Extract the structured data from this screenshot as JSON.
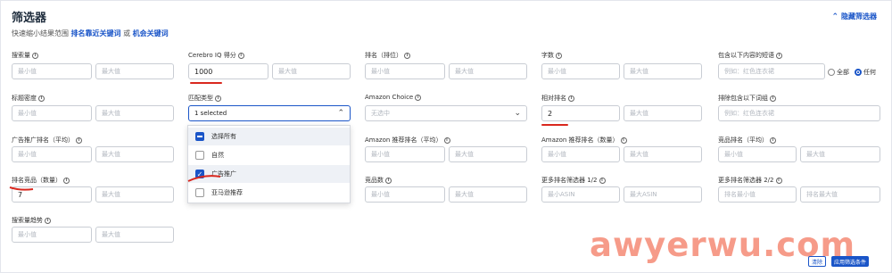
{
  "header": {
    "title": "筛选器",
    "subtitle_prefix": "快速缩小结果范围",
    "subtitle_link1": "排名靠近关键词",
    "subtitle_or": "或",
    "subtitle_link2": "机会关键词",
    "hide_label": "隐藏筛选器"
  },
  "placeholders": {
    "min": "最小值",
    "max": "最大值",
    "example": "例如：红色连衣裙",
    "min_asin": "最小ASIN",
    "max_asin": "最大ASIN",
    "rank_min": "排名最小值",
    "rank_max": "排名最大值"
  },
  "filters": {
    "search_volume": {
      "label": "搜索量"
    },
    "cerebro_iq": {
      "label": "Cerebro IQ 得分",
      "min_value": "1000"
    },
    "rank_position": {
      "label": "排名（排位）"
    },
    "word_count": {
      "label": "字数"
    },
    "phrase_contains": {
      "label": "包含以下内容的短语",
      "radio_all": "全部",
      "radio_any": "任何",
      "selected": "任何"
    },
    "title_density": {
      "label": "标题密度"
    },
    "match_type": {
      "label": "匹配类型",
      "value": "1 selected"
    },
    "amazon_choice": {
      "label": "Amazon Choice",
      "value": "无选中"
    },
    "relative_rank": {
      "label": "相对排名",
      "min_value": "2"
    },
    "exclude_words": {
      "label": "排除包含以下词组"
    },
    "ad_rank_avg": {
      "label": "广告推广排名（平均）"
    },
    "amazon_rec_rank_avg": {
      "label": "Amazon 推荐排名（平均）"
    },
    "amazon_rec_rank_count": {
      "label": "Amazon 推荐排名（数量）"
    },
    "competitor_rank_avg": {
      "label": "竞品排名（平均）"
    },
    "ranked_competitors": {
      "label": "排名竞品（数量）",
      "min_value": "7"
    },
    "competitor_count": {
      "label": "竞品数"
    },
    "more_rank_1": {
      "label": "更多排名筛选器 1/2"
    },
    "more_rank_2": {
      "label": "更多排名筛选器 2/2"
    },
    "search_trend": {
      "label": "搜索量趋势"
    }
  },
  "dropdown": {
    "options": [
      {
        "label": "选择所有",
        "state": "indeterminate"
      },
      {
        "label": "自然",
        "state": "unchecked"
      },
      {
        "label": "广告推广",
        "state": "checked"
      },
      {
        "label": "亚马逊推荐",
        "state": "unchecked"
      }
    ]
  },
  "buttons": {
    "clear": "清除",
    "apply": "应用筛选条件"
  },
  "watermark": "awyerwu.com",
  "colors": {
    "accent": "#1a55c8",
    "annotation_red": "#d9281e",
    "watermark": "#f04a2a"
  }
}
